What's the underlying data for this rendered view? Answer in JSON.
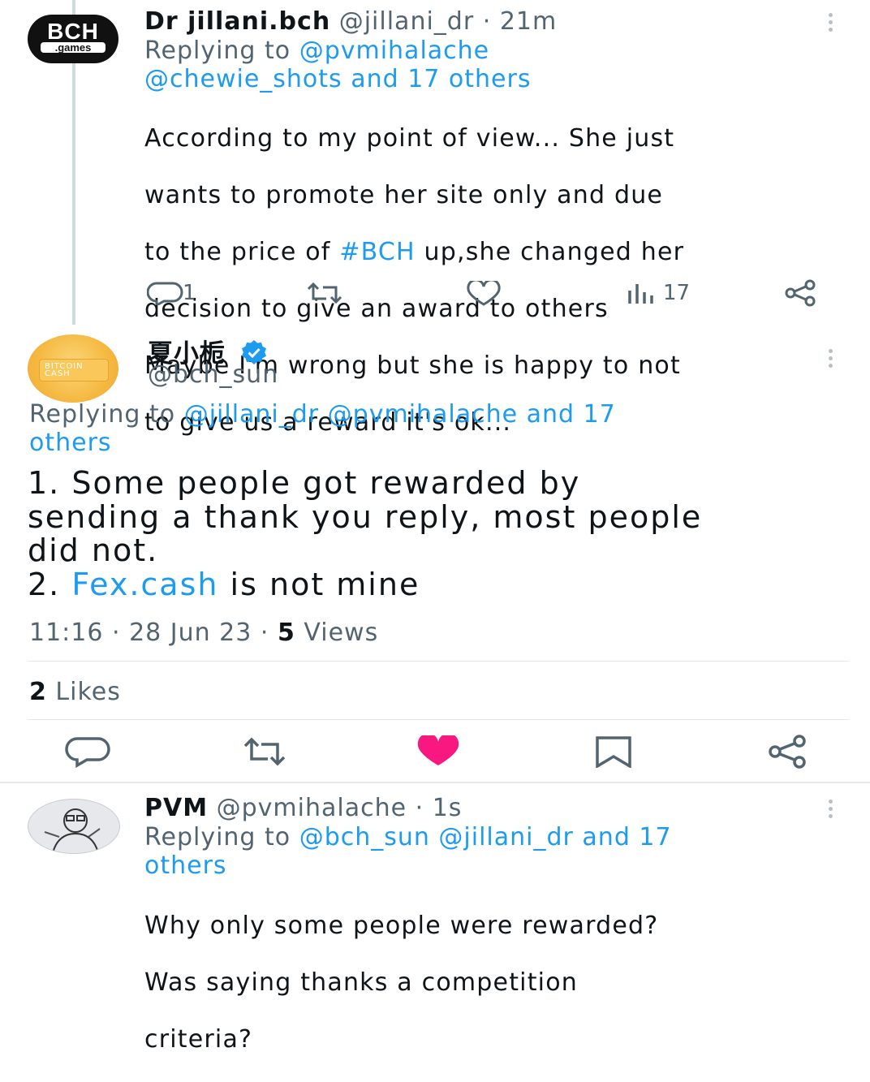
{
  "tweet1": {
    "avatar_text_main": "BCH",
    "avatar_text_sub": ".games",
    "display_name": "Dr jillani.bch",
    "handle": "@jillani_dr",
    "time": "21m",
    "replying_prefix": "Replying to",
    "replying_line1": "@pvmihalache",
    "replying_line2": "@chewie_shots and 17 others",
    "body_line1": "According to my point of view... She just",
    "body_line2": "wants to promote her site  only and due",
    "body_line3_a": "to the price of ",
    "body_line3_hashtag": "#BCH",
    "body_line3_b": " up,she changed her",
    "body_line4": "decision to give an award to others",
    "body_line5": "Maybe I'm wrong but she is happy to not",
    "body_line6": "to give us a reward it's ok...",
    "reply_count": "1",
    "views_count": "17"
  },
  "tweet2": {
    "avatar_text": "BITCOIN CASH",
    "display_name": "夏小栀",
    "handle": "@bch_sun",
    "replying_prefix": "Replying to",
    "replying_line1": "@jillani_dr @pvmihalache and 17",
    "replying_line2": "others",
    "body_line1": "1. Some people got rewarded by",
    "body_line2": "sending a thank you reply, most people",
    "body_line3": "did not.",
    "body_line4_a": "2. ",
    "body_line4_link": "Fex.cash",
    "body_line4_b": " is not mine",
    "timestamp": "11:16 · 28 Jun 23 · ",
    "views_count": "5",
    "views_label": " Views",
    "likes_count": "2",
    "likes_label": " Likes"
  },
  "tweet3": {
    "display_name": "PVM",
    "handle": "@pvmihalache",
    "time": "1s",
    "replying_prefix": "Replying to",
    "replying_line1": "@bch_sun @jillani_dr and 17",
    "replying_line2": "others",
    "body_line1": "Why only some people were rewarded?",
    "body_line2": "Was saying thanks a competition",
    "body_line3": "criteria?"
  },
  "colors": {
    "accent": "#1d9bf0",
    "like_active": "#f91880",
    "muted": "#536471",
    "verified": "#1d9bf0"
  },
  "icons": {
    "reply": "reply-icon",
    "retweet": "retweet-icon",
    "like": "heart-icon",
    "views": "views-icon",
    "share": "share-icon",
    "bookmark": "bookmark-icon",
    "more": "more-icon",
    "verified": "verified-badge-icon"
  }
}
